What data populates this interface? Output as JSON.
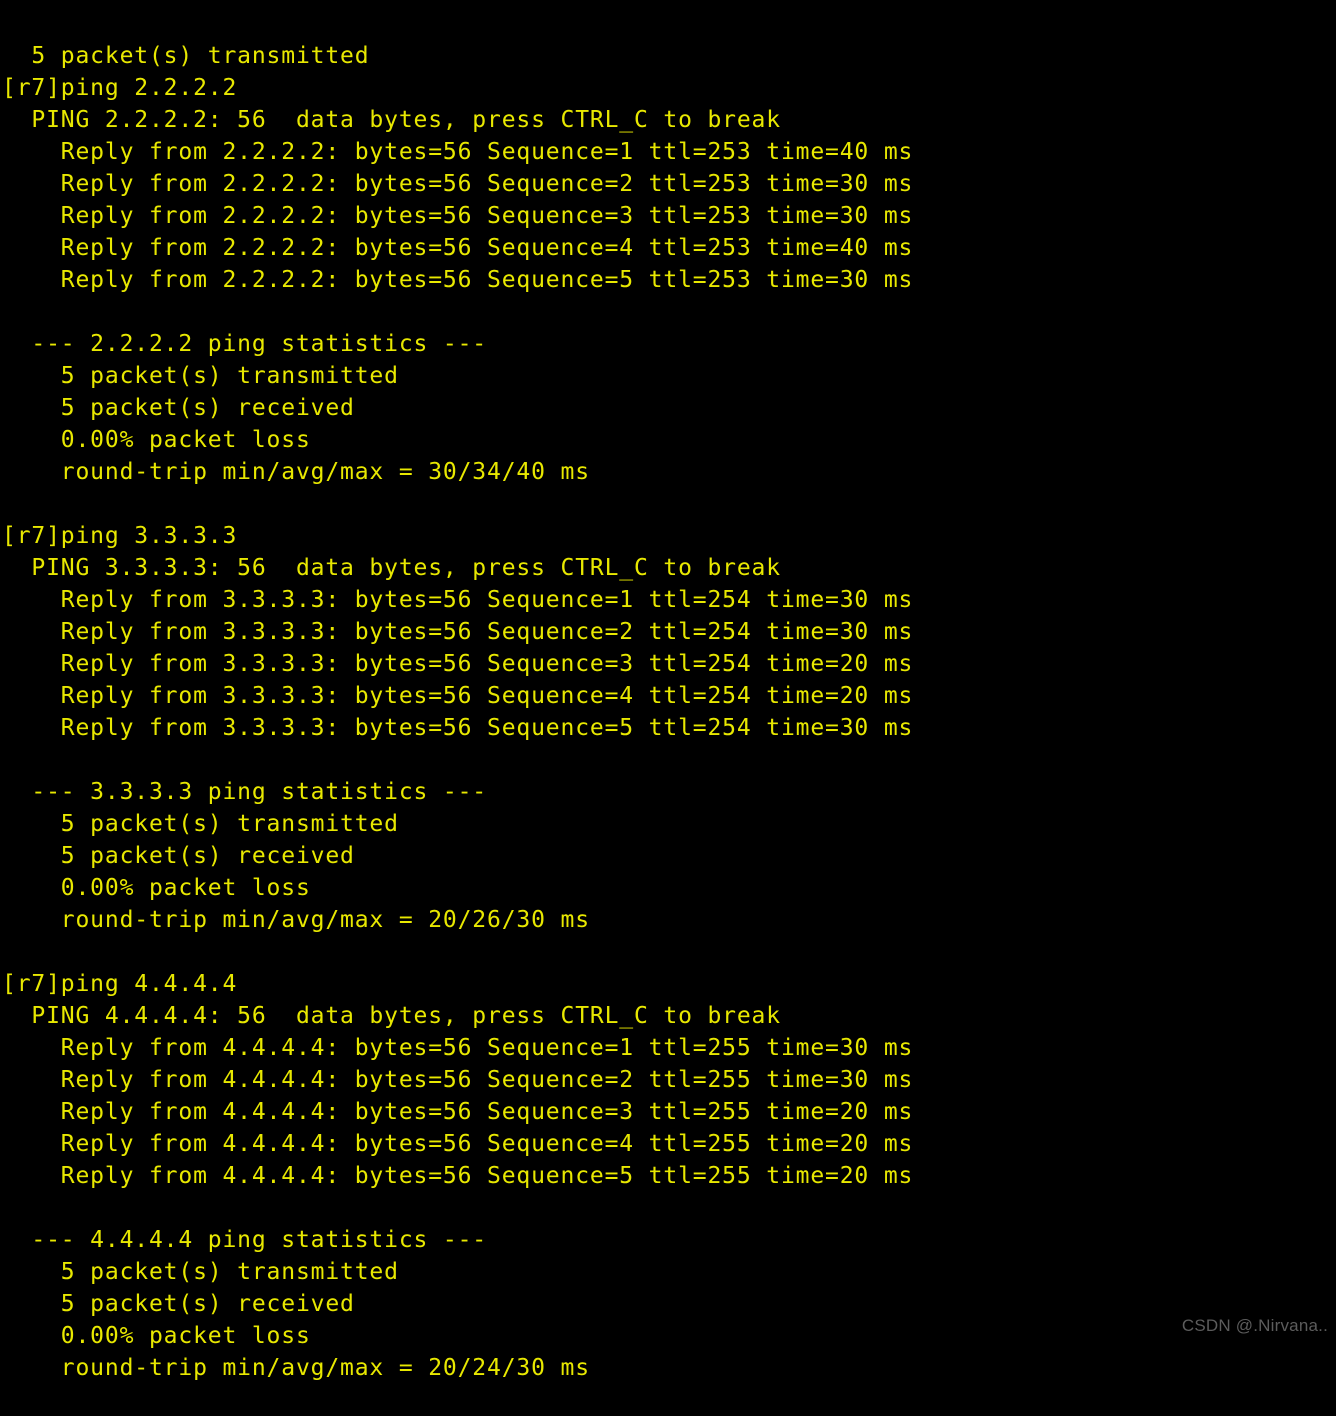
{
  "terminal": {
    "background_color": "#000000",
    "text_color": "#e8e800",
    "prompt": "[r7]",
    "scrollback_partial_top_line": "5 packet(s) transmitted",
    "sessions": [
      {
        "command_line": "[r7]ping 2.2.2.2",
        "header_line": "  PING 2.2.2.2: 56  data bytes, press CTRL_C to break",
        "target": "2.2.2.2",
        "data_bytes": "56",
        "replies": [
          "    Reply from 2.2.2.2: bytes=56 Sequence=1 ttl=253 time=40 ms",
          "    Reply from 2.2.2.2: bytes=56 Sequence=2 ttl=253 time=30 ms",
          "    Reply from 2.2.2.2: bytes=56 Sequence=3 ttl=253 time=30 ms",
          "    Reply from 2.2.2.2: bytes=56 Sequence=4 ttl=253 time=40 ms",
          "    Reply from 2.2.2.2: bytes=56 Sequence=5 ttl=253 time=30 ms"
        ],
        "stats_header": "  --- 2.2.2.2 ping statistics ---",
        "stats": [
          "    5 packet(s) transmitted",
          "    5 packet(s) received",
          "    0.00% packet loss",
          "    round-trip min/avg/max = 30/34/40 ms"
        ]
      },
      {
        "command_line": "[r7]ping 3.3.3.3",
        "header_line": "  PING 3.3.3.3: 56  data bytes, press CTRL_C to break",
        "target": "3.3.3.3",
        "data_bytes": "56",
        "replies": [
          "    Reply from 3.3.3.3: bytes=56 Sequence=1 ttl=254 time=30 ms",
          "    Reply from 3.3.3.3: bytes=56 Sequence=2 ttl=254 time=30 ms",
          "    Reply from 3.3.3.3: bytes=56 Sequence=3 ttl=254 time=20 ms",
          "    Reply from 3.3.3.3: bytes=56 Sequence=4 ttl=254 time=20 ms",
          "    Reply from 3.3.3.3: bytes=56 Sequence=5 ttl=254 time=30 ms"
        ],
        "stats_header": "  --- 3.3.3.3 ping statistics ---",
        "stats": [
          "    5 packet(s) transmitted",
          "    5 packet(s) received",
          "    0.00% packet loss",
          "    round-trip min/avg/max = 20/26/30 ms"
        ]
      },
      {
        "command_line": "[r7]ping 4.4.4.4",
        "header_line": "  PING 4.4.4.4: 56  data bytes, press CTRL_C to break",
        "target": "4.4.4.4",
        "data_bytes": "56",
        "replies": [
          "    Reply from 4.4.4.4: bytes=56 Sequence=1 ttl=255 time=30 ms",
          "    Reply from 4.4.4.4: bytes=56 Sequence=2 ttl=255 time=30 ms",
          "    Reply from 4.4.4.4: bytes=56 Sequence=3 ttl=255 time=20 ms",
          "    Reply from 4.4.4.4: bytes=56 Sequence=4 ttl=255 time=20 ms",
          "    Reply from 4.4.4.4: bytes=56 Sequence=5 ttl=255 time=20 ms"
        ],
        "stats_header": "  --- 4.4.4.4 ping statistics ---",
        "stats": [
          "    5 packet(s) transmitted",
          "    5 packet(s) received",
          "    0.00% packet loss",
          "    round-trip min/avg/max = 20/24/30 ms"
        ]
      }
    ],
    "lines": [
      "  5 packet(s) transmitted",
      "[r7]ping 2.2.2.2",
      "  PING 2.2.2.2: 56  data bytes, press CTRL_C to break",
      "    Reply from 2.2.2.2: bytes=56 Sequence=1 ttl=253 time=40 ms",
      "    Reply from 2.2.2.2: bytes=56 Sequence=2 ttl=253 time=30 ms",
      "    Reply from 2.2.2.2: bytes=56 Sequence=3 ttl=253 time=30 ms",
      "    Reply from 2.2.2.2: bytes=56 Sequence=4 ttl=253 time=40 ms",
      "    Reply from 2.2.2.2: bytes=56 Sequence=5 ttl=253 time=30 ms",
      "",
      "  --- 2.2.2.2 ping statistics ---",
      "    5 packet(s) transmitted",
      "    5 packet(s) received",
      "    0.00% packet loss",
      "    round-trip min/avg/max = 30/34/40 ms",
      "",
      "[r7]ping 3.3.3.3",
      "  PING 3.3.3.3: 56  data bytes, press CTRL_C to break",
      "    Reply from 3.3.3.3: bytes=56 Sequence=1 ttl=254 time=30 ms",
      "    Reply from 3.3.3.3: bytes=56 Sequence=2 ttl=254 time=30 ms",
      "    Reply from 3.3.3.3: bytes=56 Sequence=3 ttl=254 time=20 ms",
      "    Reply from 3.3.3.3: bytes=56 Sequence=4 ttl=254 time=20 ms",
      "    Reply from 3.3.3.3: bytes=56 Sequence=5 ttl=254 time=30 ms",
      "",
      "  --- 3.3.3.3 ping statistics ---",
      "    5 packet(s) transmitted",
      "    5 packet(s) received",
      "    0.00% packet loss",
      "    round-trip min/avg/max = 20/26/30 ms",
      "",
      "[r7]ping 4.4.4.4",
      "  PING 4.4.4.4: 56  data bytes, press CTRL_C to break",
      "    Reply from 4.4.4.4: bytes=56 Sequence=1 ttl=255 time=30 ms",
      "    Reply from 4.4.4.4: bytes=56 Sequence=2 ttl=255 time=30 ms",
      "    Reply from 4.4.4.4: bytes=56 Sequence=3 ttl=255 time=20 ms",
      "    Reply from 4.4.4.4: bytes=56 Sequence=4 ttl=255 time=20 ms",
      "    Reply from 4.4.4.4: bytes=56 Sequence=5 ttl=255 time=20 ms",
      "",
      "  --- 4.4.4.4 ping statistics ---",
      "    5 packet(s) transmitted",
      "    5 packet(s) received",
      "    0.00% packet loss",
      "    round-trip min/avg/max = 20/24/30 ms"
    ]
  },
  "watermark": {
    "text": "CSDN @.Nirvana..",
    "color": "#5c5c5c"
  }
}
